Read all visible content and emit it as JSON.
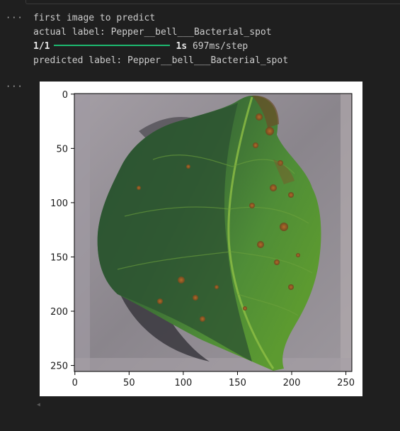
{
  "cell_output": {
    "gutter_more_1": "···",
    "gutter_more_2": "···",
    "line1": "first image to predict",
    "line2": "actual label: Pepper__bell___Bacterial_spot",
    "progress": {
      "steps": "1/1",
      "fraction_complete": 1.0,
      "time": "1s",
      "per_step": "697ms/step"
    },
    "line4": "predicted label: Pepper__bell___Bacterial_spot"
  },
  "chart_data": {
    "type": "image",
    "x_ticks": [
      0,
      50,
      100,
      150,
      200,
      250
    ],
    "y_ticks": [
      0,
      50,
      100,
      150,
      200,
      250
    ],
    "xlim": [
      -0.5,
      255.5
    ],
    "ylim": [
      255.5,
      -0.5
    ],
    "image_content": "pepper-bell-leaf-with-bacterial-spots"
  },
  "colors": {
    "background": "#1f1f1f",
    "progress": "#1db970",
    "leaf_dark": "#2f5c32",
    "leaf_light": "#4d8a3a",
    "spot": "#a8632a",
    "ground": "#8f8b8f"
  },
  "scroll_left_icon": "◀"
}
